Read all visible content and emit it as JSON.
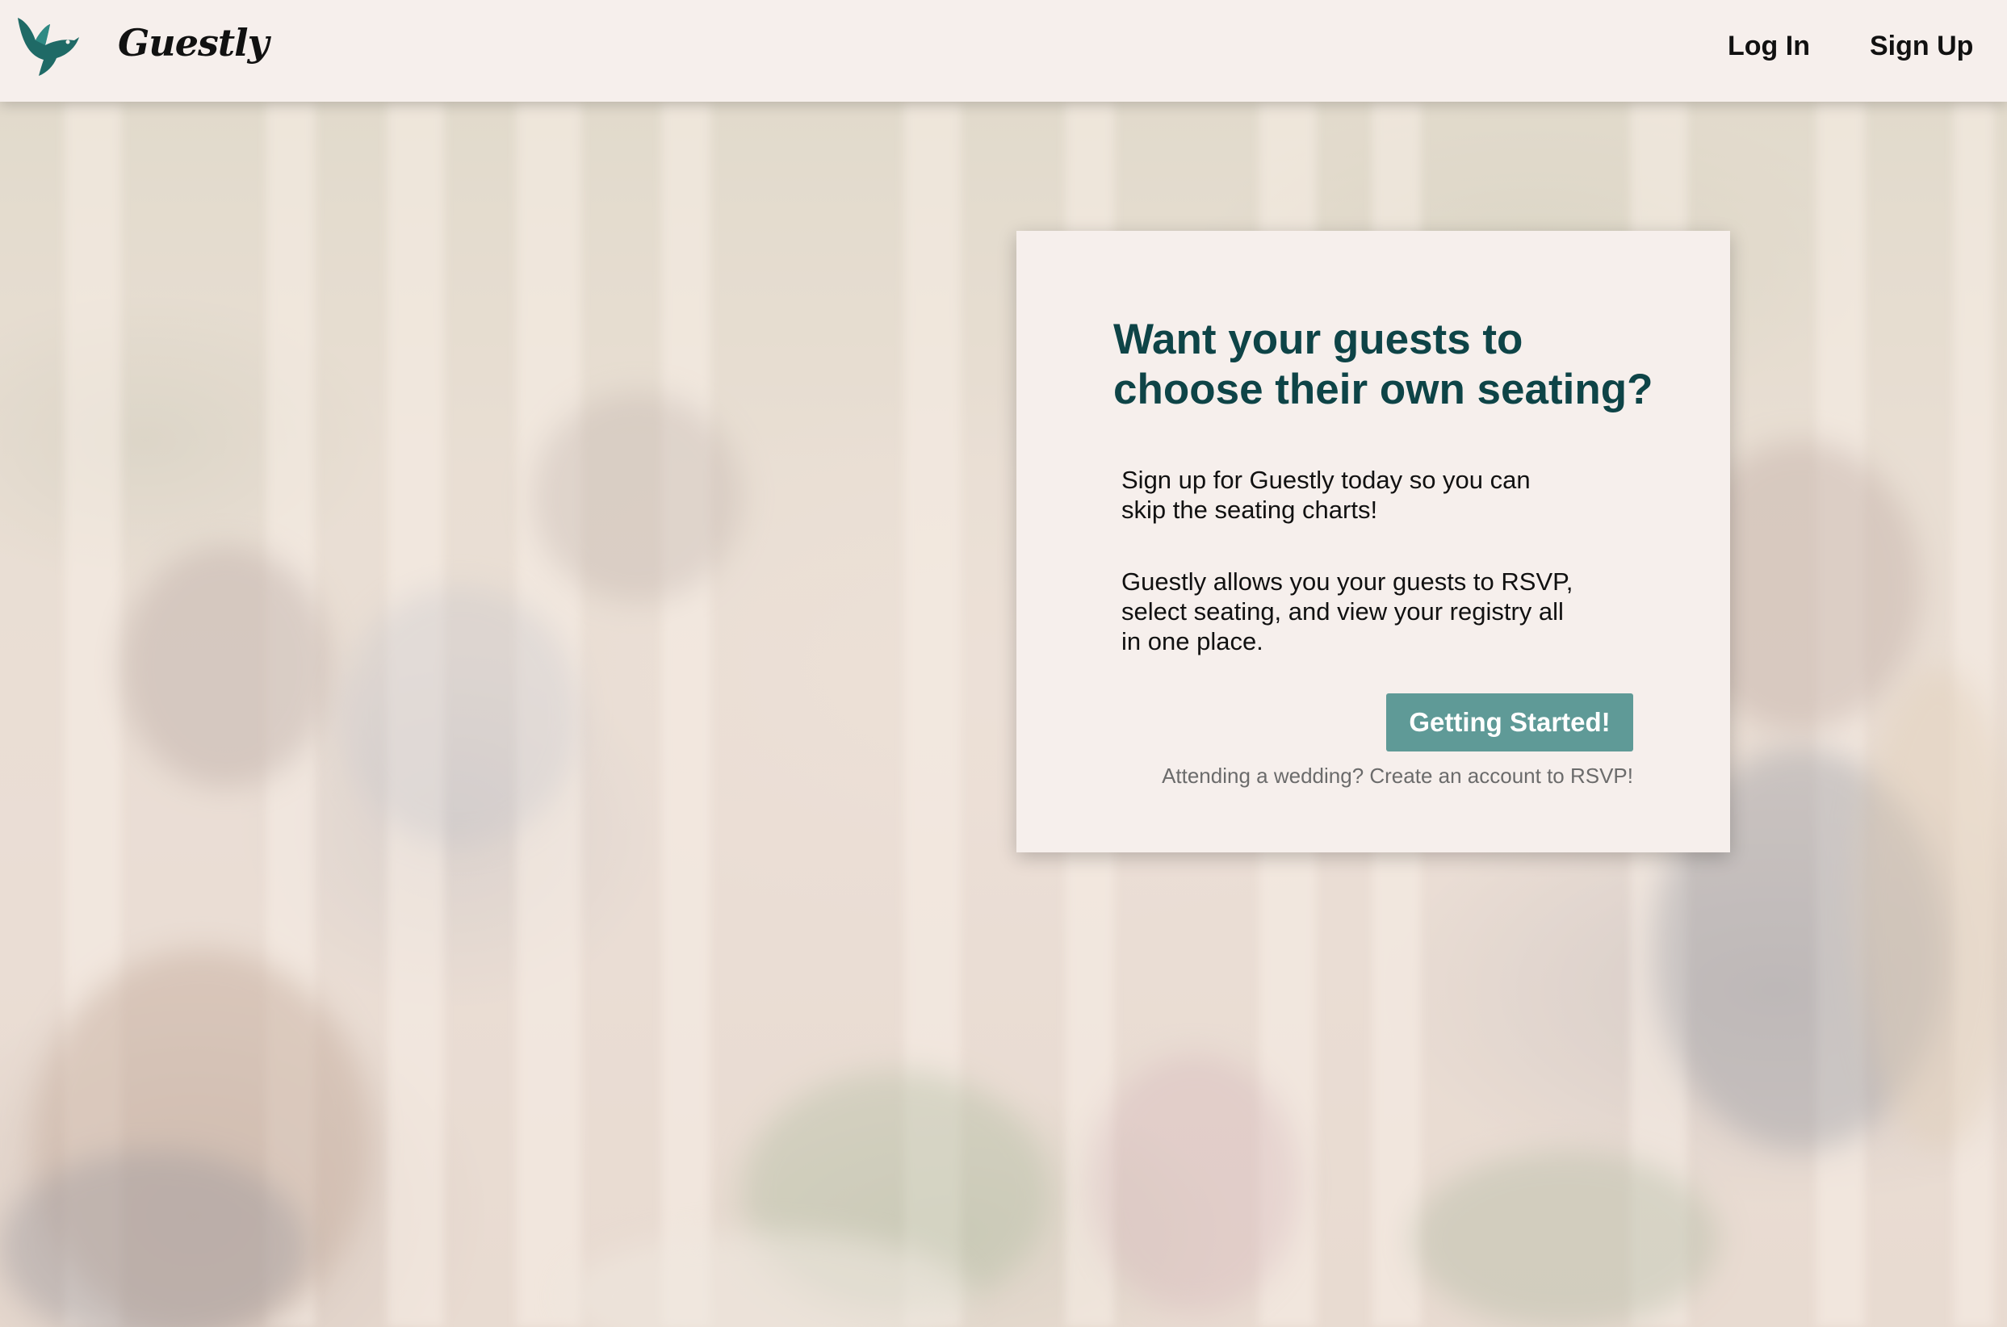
{
  "header": {
    "brand": "Guestly",
    "logo_icon": "bird-icon",
    "nav": {
      "login": "Log In",
      "signup": "Sign Up"
    }
  },
  "card": {
    "title": "Want your guests to choose their own seating?",
    "paragraph1": "Sign up for Guestly today so you can skip the seating charts!",
    "paragraph2": "Guestly allows you your guests to RSVP, select seating, and view your registry all in one place.",
    "cta_label": "Getting Started!",
    "attend_note": "Attending a wedding? Create an account to RSVP!"
  },
  "colors": {
    "brand_teal_dark": "#0e4447",
    "button_teal": "#5f9a97",
    "logo_teal": "#1f6a66",
    "surface": "#f6efec"
  }
}
